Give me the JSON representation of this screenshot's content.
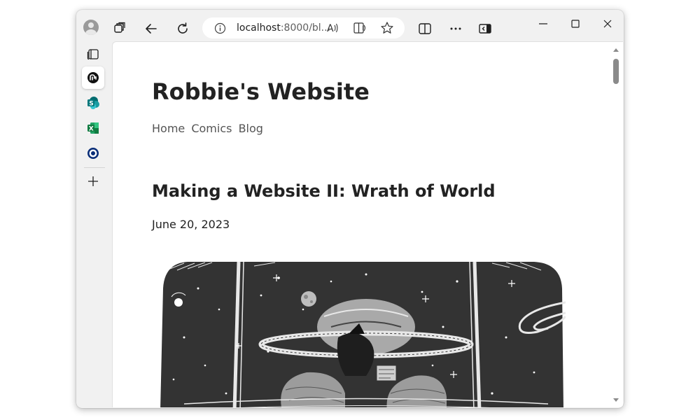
{
  "browser": {
    "address_url_main": "localhost",
    "address_url_rest": ":8000/bl...",
    "icons": [
      "profile-icon",
      "workspaces-icon",
      "back-icon",
      "refresh-icon",
      "info-icon",
      "read-aloud-icon",
      "immersive-reader-icon",
      "favorite-star-icon",
      "split-screen-icon",
      "more-icon",
      "sidebar-toggle-icon",
      "minimize-icon",
      "maximize-icon",
      "close-icon"
    ]
  },
  "sidebar": {
    "items": [
      "tabs-icon",
      "copilot-icon",
      "sharepoint-icon",
      "excel-icon",
      "outlook-icon",
      "add-icon"
    ]
  },
  "page": {
    "site_title": "Robbie's Website",
    "nav": [
      "Home",
      "Comics",
      "Blog"
    ],
    "post_title": "Making a Website II: Wrath of World",
    "post_date": "June 20, 2023"
  },
  "colors": {
    "comic_bg": "#333333",
    "text": "#222222",
    "nav": "#555555"
  }
}
